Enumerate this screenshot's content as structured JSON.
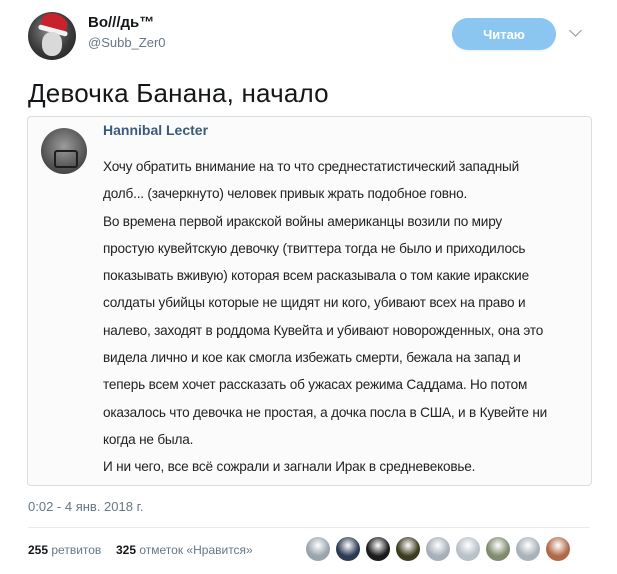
{
  "author": {
    "display_name": "Во///дь™",
    "handle": "@Subb_Zer0"
  },
  "follow_button": {
    "label": "Читаю"
  },
  "tweet": {
    "text": "Девочка Банана, начало",
    "timestamp": "0:02 - 4 янв. 2018 г."
  },
  "quoted": {
    "author": "Hannibal Lecter",
    "lines": [
      "Хочу обратить внимание на то что среднестатистический западный",
      "долб... (зачеркнуто) человек привык жрать подобное говно.",
      "Во времена первой иракской войны американцы возили по миру",
      "простую кувейтскую девочку (твиттера тогда не было и приходилось",
      "показывать вживую) которая всем расказывала о том какие иракские",
      "солдаты убийцы которые не щидят ни кого, убивают всех на право и",
      "налево, заходят в роддома Кувейта и убивают новорожденных, она это",
      "видела лично и кое как смогла избежать смерти, бежала на запад и",
      "теперь всем хочет рассказать об ужасах режима Саддама. Но потом",
      "оказалось что девочка не простая, а дочка посла в США, и в Кувейте ни",
      "когда не была.",
      "И ни чего, все всё сожрали и загнали Ирак в средневековье."
    ]
  },
  "stats": {
    "retweets_count": "255",
    "retweets_label": "ретвитов",
    "likes_count": "325",
    "likes_label": "отметок «Нравится»"
  },
  "likers_colors": [
    "#9aa4ad",
    "#2b3a55",
    "#1c1c1c",
    "#3c3c20",
    "#a7b0b8",
    "#b8c0c8",
    "#7f8a6e",
    "#a9b2ba",
    "#b06a48"
  ]
}
